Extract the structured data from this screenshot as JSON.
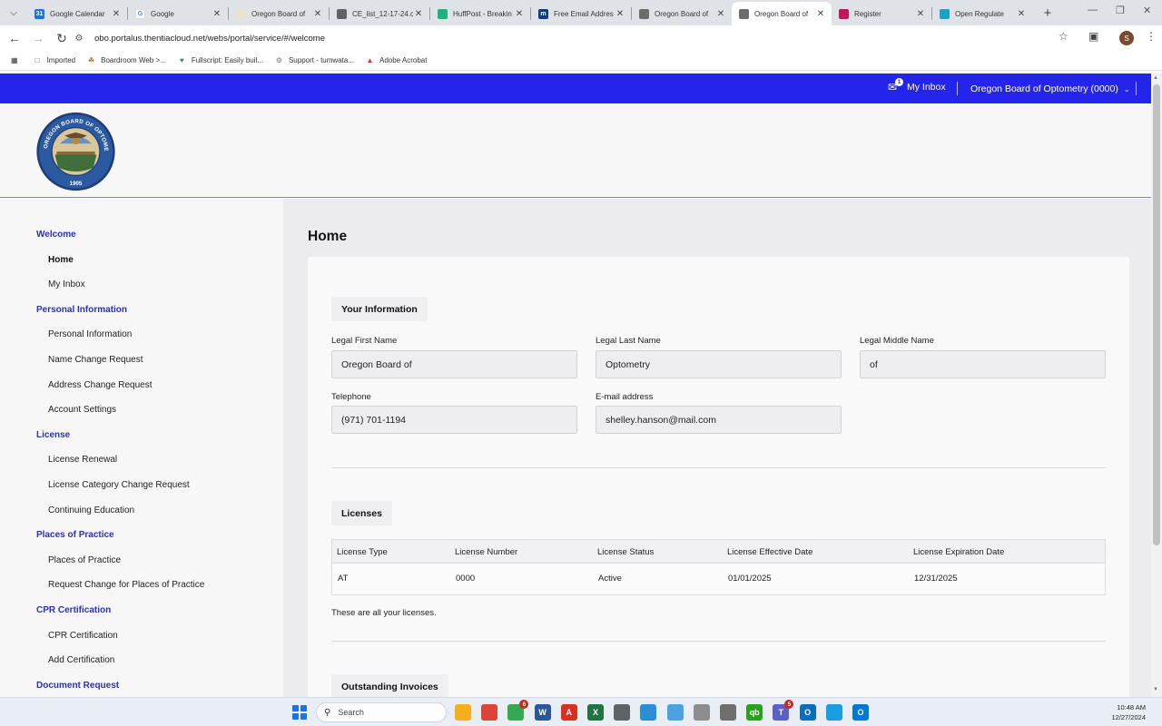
{
  "browser": {
    "tabs": [
      {
        "title": "Google Calendar",
        "fav_color": "#1a73e8",
        "fav_glyph": "31",
        "active": false
      },
      {
        "title": "Google",
        "fav_color": "#ffffff",
        "fav_glyph": "G",
        "active": false
      },
      {
        "title": "Oregon Board of",
        "fav_color": "#e8e4d0",
        "fav_glyph": "",
        "active": false
      },
      {
        "title": "CE_list_12-17-24.c",
        "fav_color": "#5f6368",
        "fav_glyph": "",
        "active": false
      },
      {
        "title": "HuffPost - Breakin",
        "fav_color": "#1fb27e",
        "fav_glyph": "",
        "active": false
      },
      {
        "title": "Free Email Addres",
        "fav_color": "#0b3d91",
        "fav_glyph": "m",
        "active": false
      },
      {
        "title": "Oregon Board of",
        "fav_color": "#6b6b6b",
        "fav_glyph": "",
        "active": false
      },
      {
        "title": "Oregon Board of",
        "fav_color": "#6b6b6b",
        "fav_glyph": "",
        "active": true
      },
      {
        "title": "Register",
        "fav_color": "#c2185b",
        "fav_glyph": "",
        "active": false
      },
      {
        "title": "Open Regulate",
        "fav_color": "#1aa3c9",
        "fav_glyph": "",
        "active": false
      }
    ],
    "url": "obo.portalus.thentiacloud.net/webs/portal/service/#/welcome",
    "avatar_initial": "S",
    "bookmarks": [
      {
        "label": "Imported",
        "icon": "folder-icon"
      },
      {
        "label": "Boardroom Web >...",
        "icon": "boardroom-icon"
      },
      {
        "label": "Fullscript: Easily buil...",
        "icon": "fullscript-icon"
      },
      {
        "label": "Support - tumwata...",
        "icon": "support-icon"
      },
      {
        "label": "Adobe Acrobat",
        "icon": "acrobat-icon"
      }
    ]
  },
  "portal": {
    "brand_color": "#2424ec",
    "inbox_label": "My Inbox",
    "inbox_count": "1",
    "account_label": "Oregon Board of Optometry (0000)",
    "seal": {
      "top_text": "OREGON BOARD OF OPTOMETRY",
      "year": "1905"
    }
  },
  "sidebar": [
    {
      "type": "section",
      "label": "Welcome"
    },
    {
      "type": "link",
      "label": "Home",
      "current": true
    },
    {
      "type": "link",
      "label": "My Inbox"
    },
    {
      "type": "section",
      "label": "Personal Information"
    },
    {
      "type": "link",
      "label": "Personal Information"
    },
    {
      "type": "link",
      "label": "Name Change Request"
    },
    {
      "type": "link",
      "label": "Address Change Request"
    },
    {
      "type": "link",
      "label": "Account Settings"
    },
    {
      "type": "section",
      "label": "License"
    },
    {
      "type": "link",
      "label": "License Renewal"
    },
    {
      "type": "link",
      "label": "License Category Change Request"
    },
    {
      "type": "link",
      "label": "Continuing Education"
    },
    {
      "type": "section",
      "label": "Places of Practice"
    },
    {
      "type": "link",
      "label": "Places of Practice"
    },
    {
      "type": "link",
      "label": "Request Change for Places of Practice"
    },
    {
      "type": "section",
      "label": "CPR Certification"
    },
    {
      "type": "link",
      "label": "CPR Certification"
    },
    {
      "type": "link",
      "label": "Add Certification"
    },
    {
      "type": "section",
      "label": "Document Request"
    }
  ],
  "main": {
    "page_title": "Home",
    "your_info": {
      "heading": "Your Information",
      "fields": {
        "first_name": {
          "label": "Legal First Name",
          "value": "Oregon Board of"
        },
        "last_name": {
          "label": "Legal Last Name",
          "value": "Optometry"
        },
        "middle_name": {
          "label": "Legal Middle Name",
          "value": "of"
        },
        "telephone": {
          "label": "Telephone",
          "value": "(971) 701-1194"
        },
        "email": {
          "label": "E-mail address",
          "value": "shelley.hanson@mail.com"
        }
      }
    },
    "licenses": {
      "heading": "Licenses",
      "columns": [
        "License Type",
        "License Number",
        "License Status",
        "License Effective Date",
        "License Expiration Date"
      ],
      "rows": [
        [
          "AT",
          "0000",
          "Active",
          "01/01/2025",
          "12/31/2025"
        ]
      ],
      "note": "These are all your licenses."
    },
    "invoices": {
      "heading": "Outstanding Invoices"
    }
  },
  "taskbar": {
    "search_placeholder": "Search",
    "apps": [
      {
        "name": "file-explorer-icon",
        "color": "#f2b01e",
        "glyph": ""
      },
      {
        "name": "chrome-icon",
        "color": "#db4437",
        "glyph": ""
      },
      {
        "name": "chrome-profile-icon",
        "color": "#34a853",
        "glyph": "",
        "badge": "6"
      },
      {
        "name": "word-icon",
        "color": "#2b579a",
        "glyph": "W"
      },
      {
        "name": "acrobat-icon",
        "color": "#d93025",
        "glyph": "A"
      },
      {
        "name": "excel-icon",
        "color": "#217346",
        "glyph": "X"
      },
      {
        "name": "printer-icon",
        "color": "#5f6368",
        "glyph": ""
      },
      {
        "name": "screenshot-icon",
        "color": "#2b8fd6",
        "glyph": ""
      },
      {
        "name": "notepad-icon",
        "color": "#4aa3df",
        "glyph": ""
      },
      {
        "name": "columns-app-icon",
        "color": "#8d8d8d",
        "glyph": ""
      },
      {
        "name": "calculator-icon",
        "color": "#6e6e6e",
        "glyph": ""
      },
      {
        "name": "quickbooks-icon",
        "color": "#2ca01c",
        "glyph": "qb"
      },
      {
        "name": "teams-icon",
        "color": "#5b5fc7",
        "glyph": "T",
        "badge": "5"
      },
      {
        "name": "outlook-icon",
        "color": "#0f6cbd",
        "glyph": "O"
      },
      {
        "name": "edge-icon",
        "color": "#1b9de2",
        "glyph": ""
      },
      {
        "name": "outlook-new-icon",
        "color": "#0078d4",
        "glyph": "O"
      }
    ],
    "time": "10:48 AM",
    "date": "12/27/2024"
  }
}
